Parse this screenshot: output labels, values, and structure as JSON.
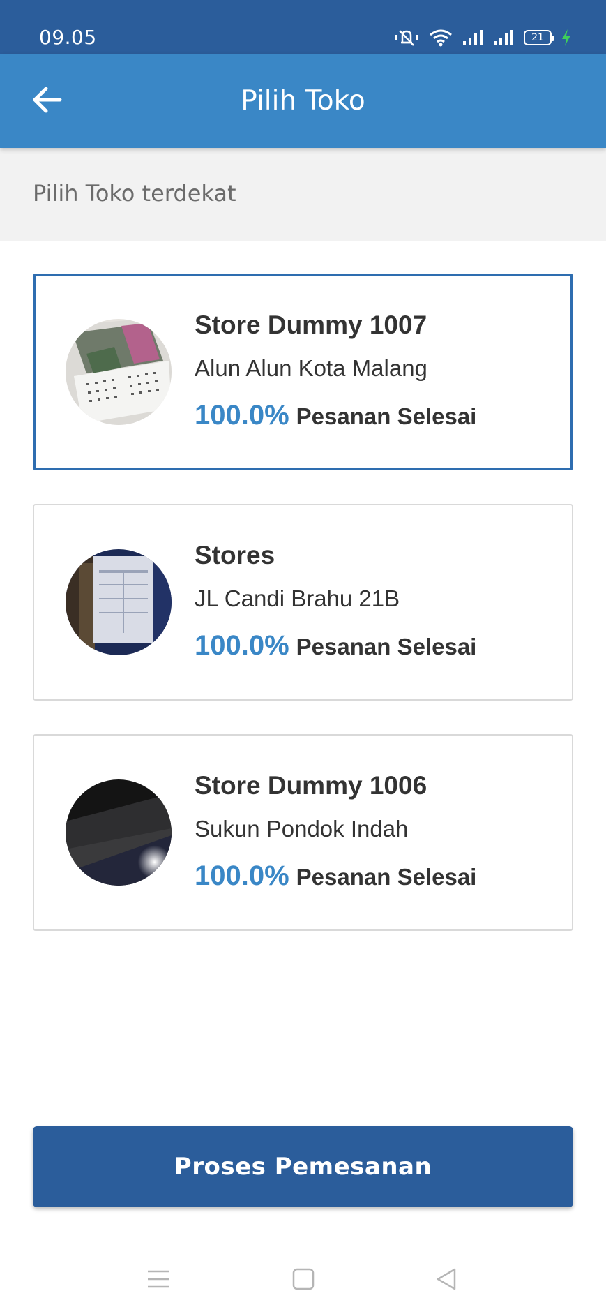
{
  "status_bar": {
    "time": "09.05",
    "battery_level": "21",
    "icons": [
      "mute-vibrate-icon",
      "wifi-icon",
      "signal-icon",
      "signal-icon",
      "battery-icon",
      "charging-icon"
    ]
  },
  "app_bar": {
    "title": "Pilih Toko",
    "back_icon": "arrow-left-icon"
  },
  "subheader": {
    "text": "Pilih Toko terdekat"
  },
  "stores": [
    {
      "name": "Store Dummy 1007",
      "address": "Alun Alun Kota Malang",
      "percentage": "100.0%",
      "status_label": "Pesanan Selesai",
      "selected": true
    },
    {
      "name": "Stores",
      "address": "JL Candi Brahu 21B",
      "percentage": "100.0%",
      "status_label": "Pesanan Selesai",
      "selected": false
    },
    {
      "name": "Store Dummy 1006",
      "address": "Sukun Pondok Indah",
      "percentage": "100.0%",
      "status_label": "Pesanan Selesai",
      "selected": false
    }
  ],
  "primary_button": {
    "label": "Proses Pemesanan"
  },
  "nav_bar": {
    "icons": [
      "menu-icon",
      "home-square-icon",
      "back-triangle-icon"
    ]
  },
  "colors": {
    "status_bar": "#2b5d9b",
    "app_bar": "#3a87c6",
    "accent": "#3a87c6",
    "selected_border": "#2e6db0",
    "primary_button": "#2b5d9b"
  }
}
